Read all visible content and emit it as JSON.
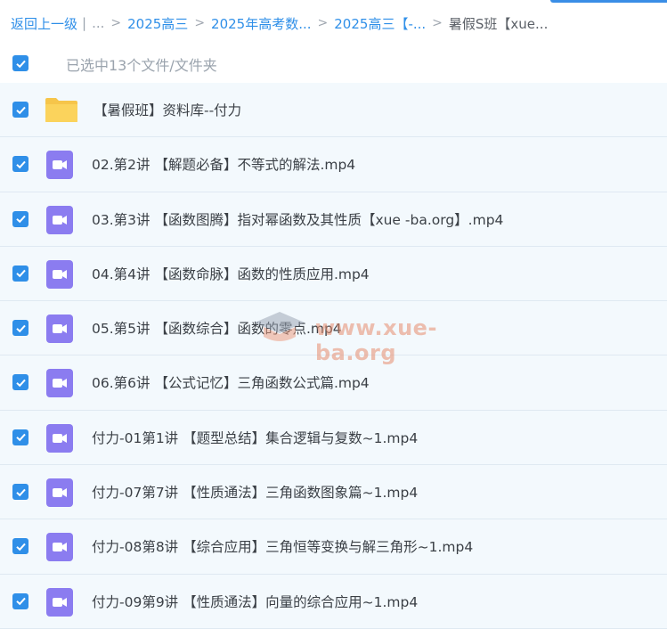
{
  "breadcrumb": {
    "back": "返回上一级",
    "pipe": "|",
    "ellipsis": "...",
    "items": [
      "2025高三",
      "2025年高考数...",
      "2025高三【-...",
      "暑假S班【xue..."
    ],
    "separator": ">"
  },
  "selection": {
    "summary": "已选中13个文件/文件夹",
    "all_checked": true
  },
  "files": [
    {
      "name": "【暑假班】资料库--付力",
      "type": "folder",
      "checked": true
    },
    {
      "name": "02.第2讲 【解题必备】不等式的解法.mp4",
      "type": "video",
      "checked": true
    },
    {
      "name": "03.第3讲 【函数图腾】指对幂函数及其性质【xue -ba.org】.mp4",
      "type": "video",
      "checked": true
    },
    {
      "name": "04.第4讲 【函数命脉】函数的性质应用.mp4",
      "type": "video",
      "checked": true
    },
    {
      "name": "05.第5讲 【函数综合】函数的零点.mp4",
      "type": "video",
      "checked": true
    },
    {
      "name": "06.第6讲 【公式记忆】三角函数公式篇.mp4",
      "type": "video",
      "checked": true
    },
    {
      "name": "付力-01第1讲 【题型总结】集合逻辑与复数~1.mp4",
      "type": "video",
      "checked": true
    },
    {
      "name": "付力-07第7讲 【性质通法】三角函数图象篇~1.mp4",
      "type": "video",
      "checked": true
    },
    {
      "name": "付力-08第8讲 【综合应用】三角恒等变换与解三角形~1.mp4",
      "type": "video",
      "checked": true
    },
    {
      "name": "付力-09第9讲 【性质通法】向量的综合应用~1.mp4",
      "type": "video",
      "checked": true
    }
  ],
  "watermark": "www.xue-ba.org",
  "colors": {
    "accent": "#2f8fe8",
    "video_icon": "#8b7cf0",
    "folder": "#f6c54a",
    "row_bg": "#f3f9fd"
  }
}
